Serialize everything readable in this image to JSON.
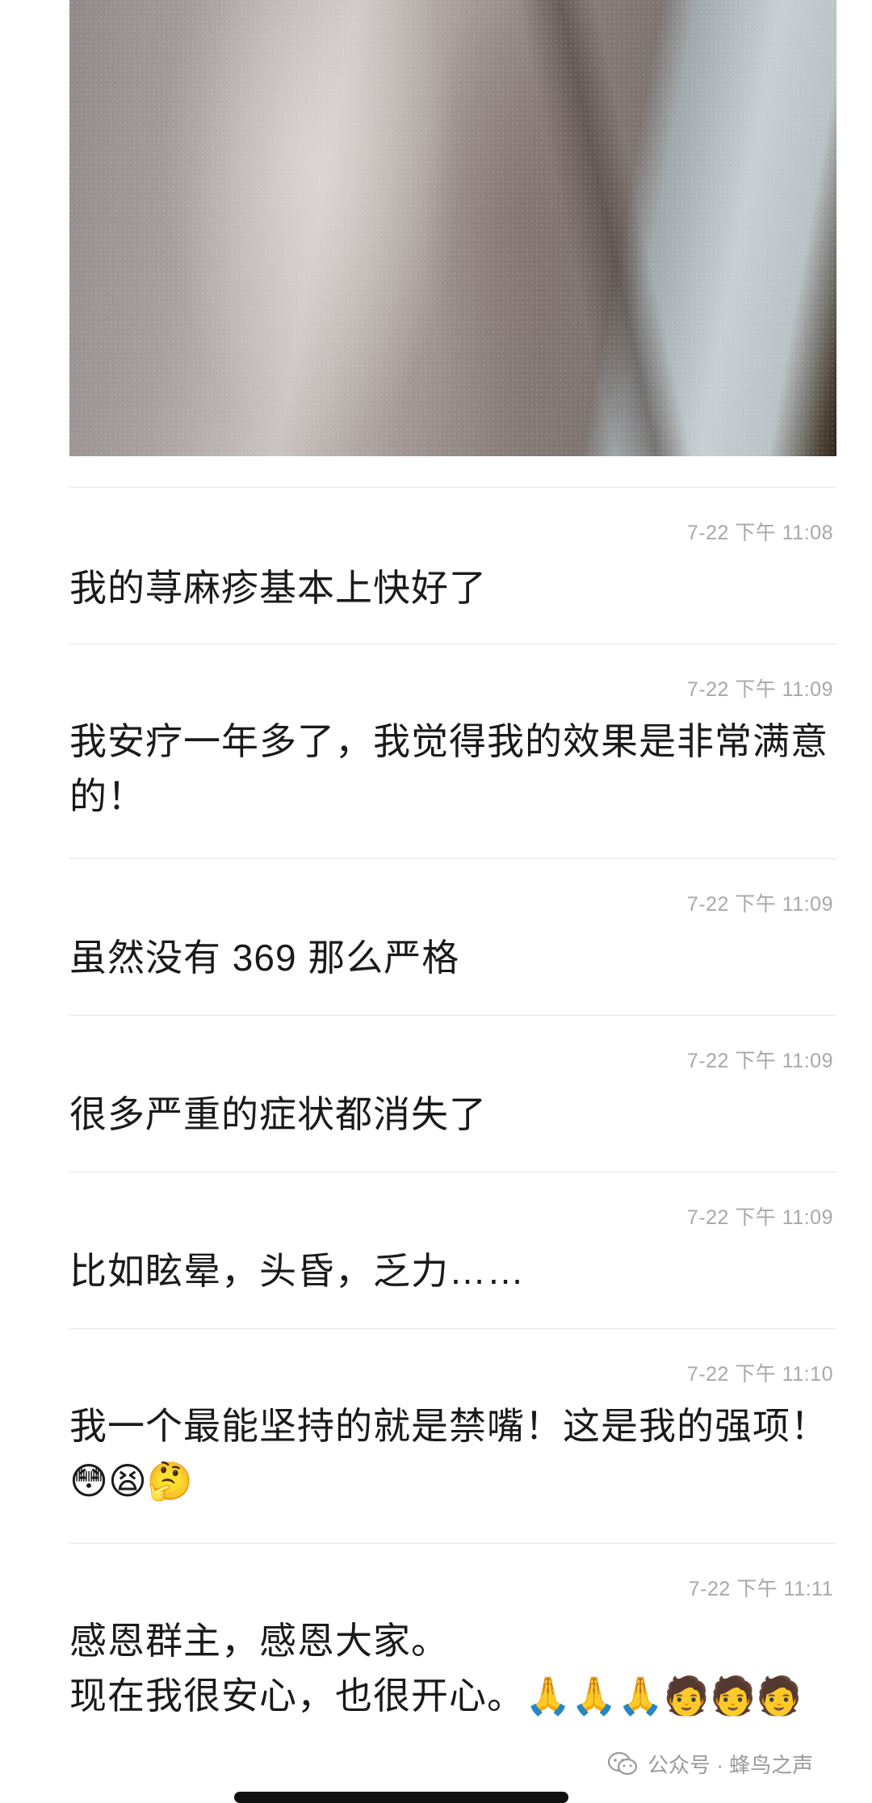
{
  "messages": [
    {
      "sender": "",
      "time": "7-22 下午 11:08",
      "text": "我的荨麻疹基本上快好了"
    },
    {
      "sender": "",
      "time": "7-22 下午 11:09",
      "text": "我安疗一年多了，我觉得我的效果是非常满意的！"
    },
    {
      "sender": "",
      "time": "7-22 下午 11:09",
      "text": "虽然没有 369 那么严格"
    },
    {
      "sender": "",
      "time": "7-22 下午 11:09",
      "text": "很多严重的症状都消失了"
    },
    {
      "sender": "",
      "time": "7-22 下午 11:09",
      "text": "比如眩晕，头昏，乏力……"
    },
    {
      "sender": "",
      "time": "7-22 下午 11:10",
      "text": "我一个最能坚持的就是禁嘴！这是我的强项！",
      "emojis": "😳😫🤔"
    },
    {
      "sender": "",
      "time": "7-22 下午 11:11",
      "text": "感恩群主，感恩大家。",
      "text2": "现在我很安心，也很开心。",
      "emojis": "🙏🙏🙏🧑🧑🧑"
    }
  ],
  "watermark": {
    "text": "公众号 · 蜂鸟之声",
    "icon": "wechat-icon"
  }
}
